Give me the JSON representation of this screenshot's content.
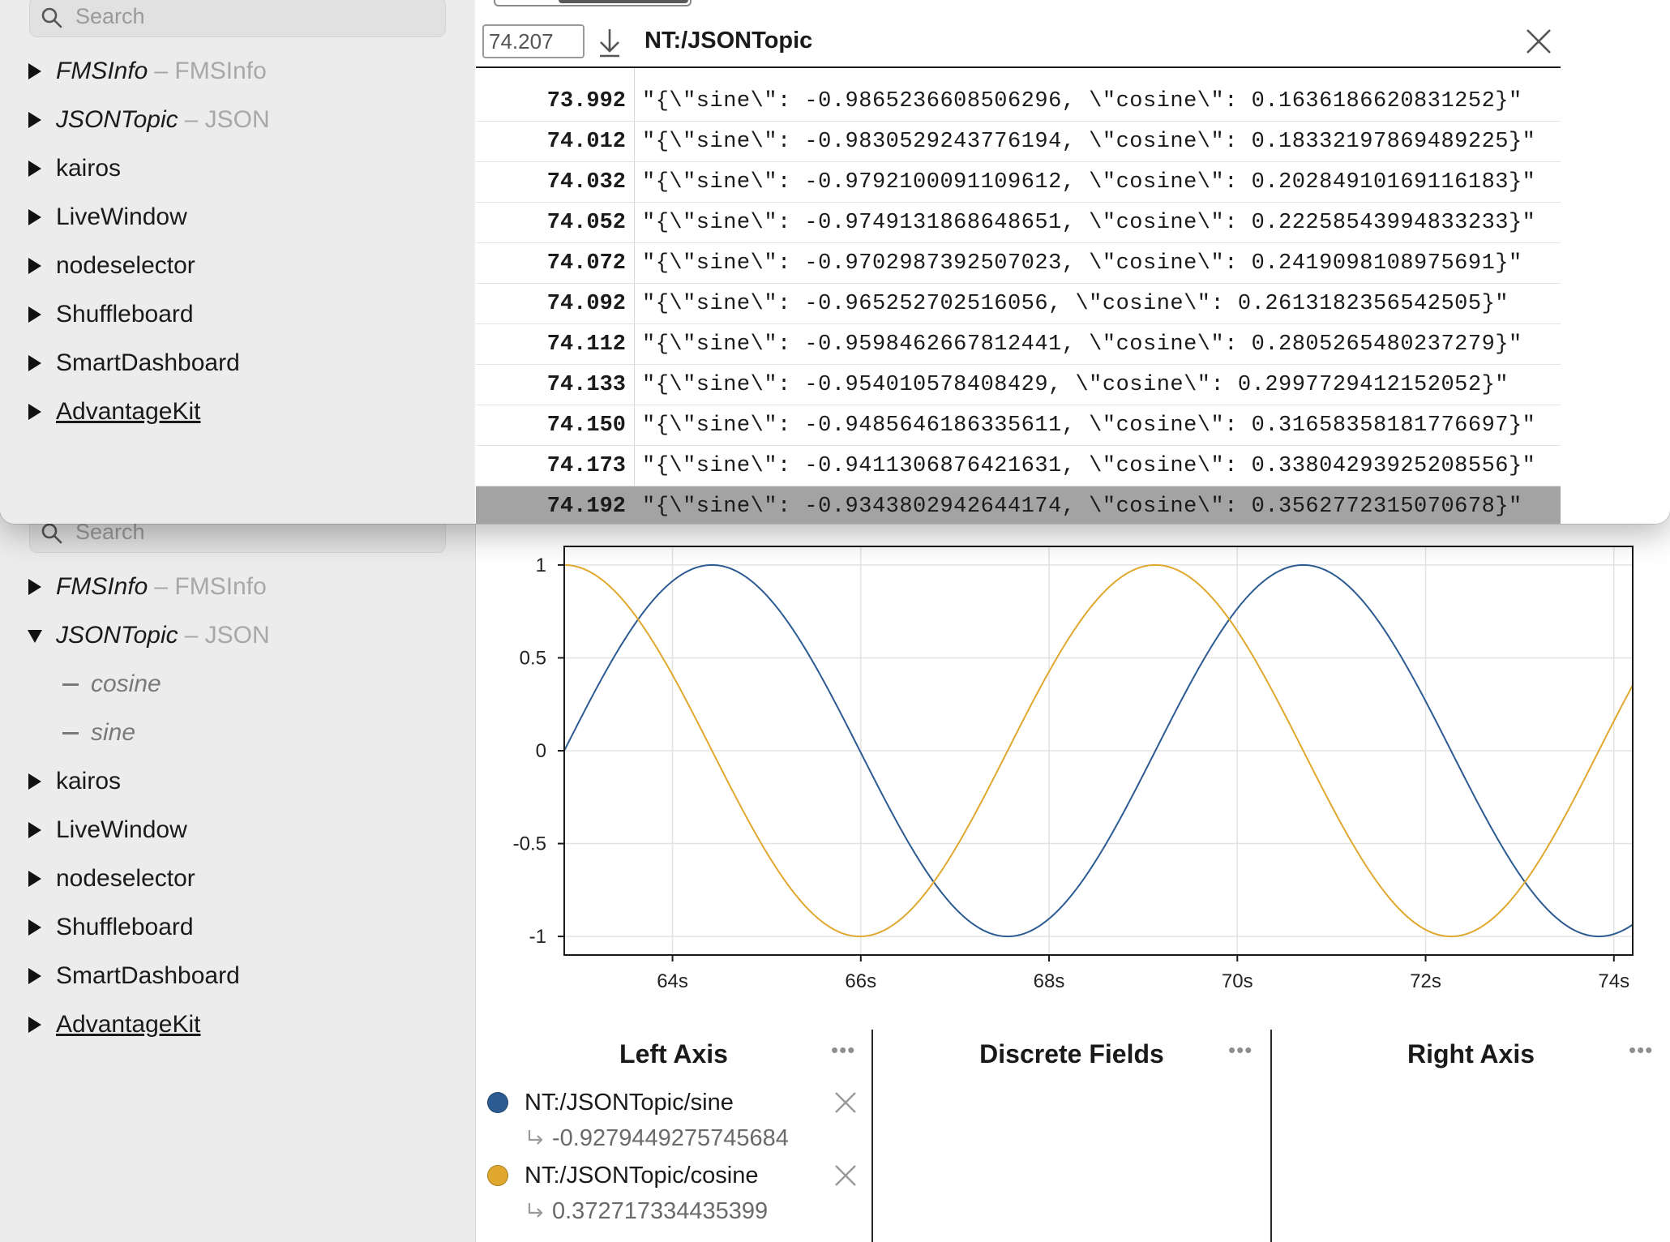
{
  "search": {
    "placeholder": "Search"
  },
  "front_tree": [
    {
      "label": "FMSInfo",
      "sub": "– FMSInfo",
      "italic": true
    },
    {
      "label": "JSONTopic",
      "sub": "– JSON",
      "italic": true
    },
    {
      "label": "kairos",
      "sub": ""
    },
    {
      "label": "LiveWindow",
      "sub": ""
    },
    {
      "label": "nodeselector",
      "sub": ""
    },
    {
      "label": "Shuffleboard",
      "sub": ""
    },
    {
      "label": "SmartDashboard",
      "sub": ""
    },
    {
      "label": "AdvantageKit",
      "sub": "",
      "underline": true
    }
  ],
  "back_tree": [
    {
      "label": "FMSInfo",
      "sub": "– FMSInfo",
      "italic": true,
      "expanded": false
    },
    {
      "label": "JSONTopic",
      "sub": "– JSON",
      "italic": true,
      "expanded": true
    },
    {
      "label": "cosine",
      "child": true
    },
    {
      "label": "sine",
      "child": true
    },
    {
      "label": "kairos",
      "sub": ""
    },
    {
      "label": "LiveWindow",
      "sub": ""
    },
    {
      "label": "nodeselector",
      "sub": ""
    },
    {
      "label": "Shuffleboard",
      "sub": ""
    },
    {
      "label": "SmartDashboard",
      "sub": ""
    },
    {
      "label": "AdvantageKit",
      "sub": "",
      "underline": true
    }
  ],
  "table_view": {
    "time_input": "74.207",
    "topic": "NT:/JSONTopic",
    "rows": [
      {
        "ts": "73.992",
        "value": "\"{\\\"sine\\\": -0.9865236608506296, \\\"cosine\\\": 0.1636186620831252}\""
      },
      {
        "ts": "74.012",
        "value": "\"{\\\"sine\\\": -0.9830529243776194, \\\"cosine\\\": 0.18332197869489225}\""
      },
      {
        "ts": "74.032",
        "value": "\"{\\\"sine\\\": -0.9792100091109612, \\\"cosine\\\": 0.20284910169116183}\""
      },
      {
        "ts": "74.052",
        "value": "\"{\\\"sine\\\": -0.9749131868648651, \\\"cosine\\\": 0.22258543994833233}\""
      },
      {
        "ts": "74.072",
        "value": "\"{\\\"sine\\\": -0.9702987392507023, \\\"cosine\\\": 0.2419098108975691}\""
      },
      {
        "ts": "74.092",
        "value": "\"{\\\"sine\\\": -0.965252702516056, \\\"cosine\\\": 0.2613182356542505}\""
      },
      {
        "ts": "74.112",
        "value": "\"{\\\"sine\\\": -0.9598462667812441, \\\"cosine\\\": 0.2805265480237279}\""
      },
      {
        "ts": "74.133",
        "value": "\"{\\\"sine\\\": -0.954010578408429, \\\"cosine\\\": 0.2997729412152052}\""
      },
      {
        "ts": "74.150",
        "value": "\"{\\\"sine\\\": -0.9485646186335611, \\\"cosine\\\": 0.31658358181776697}\""
      },
      {
        "ts": "74.173",
        "value": "\"{\\\"sine\\\": -0.9411306876421631, \\\"cosine\\\": 0.33804293925208556}\""
      },
      {
        "ts": "74.192",
        "value": "\"{\\\"sine\\\": -0.9343802942644174, \\\"cosine\\\": 0.3562772315070678}\"",
        "selected": true
      }
    ]
  },
  "chart_data": {
    "type": "line",
    "x_unit_suffix": "s",
    "xlim": [
      62.85,
      74.2
    ],
    "ylim": [
      -1.1,
      1.1
    ],
    "x_ticks": [
      64,
      66,
      68,
      70,
      72,
      74
    ],
    "y_ticks": [
      1,
      0.5,
      0,
      -0.5,
      -1
    ],
    "y_tick_labels": [
      "1",
      "0.5",
      "0",
      "-0.5",
      "-1"
    ],
    "grid": true,
    "series": [
      {
        "name": "NT:/JSONTopic/sine",
        "color": "#2c5b92",
        "function": "sine",
        "period": 6.28,
        "phase_x": 62.85
      },
      {
        "name": "NT:/JSONTopic/cosine",
        "color": "#e0a82e",
        "function": "cosine",
        "period": 6.28,
        "phase_x": 62.85
      }
    ]
  },
  "legend": {
    "left_title": "Left Axis",
    "discrete_title": "Discrete Fields",
    "right_title": "Right Axis",
    "more": "•••",
    "items": [
      {
        "name": "NT:/JSONTopic/sine",
        "value": "-0.9279449275745684",
        "color": "#2c5b92"
      },
      {
        "name": "NT:/JSONTopic/cosine",
        "value": "0.372717334435399",
        "color": "#e0a82e"
      }
    ]
  }
}
